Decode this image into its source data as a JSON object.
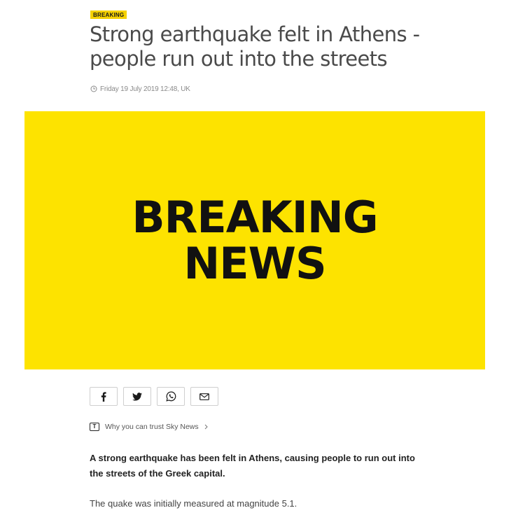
{
  "article": {
    "badge": "BREAKING",
    "headline": "Strong earthquake felt in Athens - people run out into the streets",
    "dateline": "Friday 19 July 2019 12:48, UK",
    "hero": {
      "line1": "BREAKING",
      "line2": "NEWS",
      "background": "#fde300"
    },
    "share": [
      {
        "network": "facebook",
        "icon": "facebook-icon"
      },
      {
        "network": "twitter",
        "icon": "twitter-icon"
      },
      {
        "network": "whatsapp",
        "icon": "whatsapp-icon"
      },
      {
        "network": "email",
        "icon": "email-icon"
      }
    ],
    "trust": {
      "icon_letter": "T",
      "label": "Why you can trust Sky News"
    },
    "lede": "A strong earthquake has been felt in Athens, causing people to run out into the streets of the Greek capital.",
    "paragraphs": [
      "The quake was initially measured at magnitude 5.1."
    ]
  },
  "colors": {
    "accent": "#f5d100",
    "hero": "#fde300"
  }
}
